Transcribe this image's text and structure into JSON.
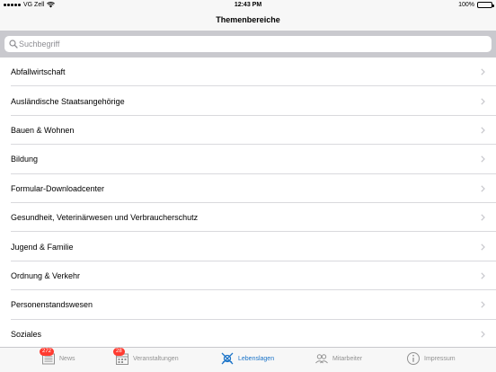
{
  "status_bar": {
    "carrier": "VG Zell",
    "time": "12:43 PM",
    "battery": "100%"
  },
  "nav": {
    "title": "Themenbereiche"
  },
  "search": {
    "placeholder": "Suchbegriff",
    "value": ""
  },
  "list": {
    "items": [
      {
        "label": "Abfallwirtschaft"
      },
      {
        "label": "Ausländische Staatsangehörige"
      },
      {
        "label": "Bauen & Wohnen"
      },
      {
        "label": "Bildung"
      },
      {
        "label": "Formular-Downloadcenter"
      },
      {
        "label": "Gesundheit, Veterinärwesen und Verbraucherschutz"
      },
      {
        "label": "Jugend & Familie"
      },
      {
        "label": "Ordnung & Verkehr"
      },
      {
        "label": "Personenstandswesen"
      },
      {
        "label": "Soziales"
      }
    ]
  },
  "tab_bar": {
    "tabs": [
      {
        "label": "News",
        "badge": "272",
        "icon": "newspaper-icon"
      },
      {
        "label": "Veranstaltungen",
        "badge": "28",
        "icon": "calendar-icon"
      },
      {
        "label": "Lebenslagen",
        "icon": "compass-icon",
        "active": true
      },
      {
        "label": "Mitarbeiter",
        "icon": "people-icon"
      },
      {
        "label": "Impressum",
        "icon": "info-icon"
      }
    ]
  },
  "colors": {
    "accent": "#1a73c8",
    "badge": "#ff3b30",
    "tab_inactive": "#929292"
  }
}
